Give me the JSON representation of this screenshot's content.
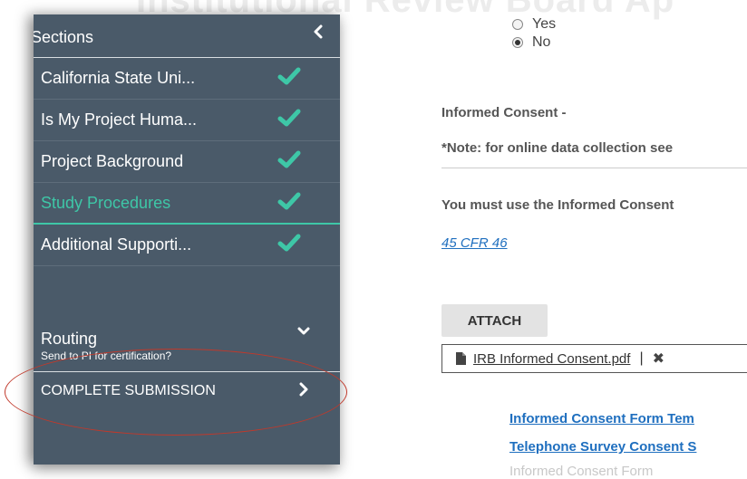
{
  "ghost_header": "Institutional Review Board Ap",
  "sidebar": {
    "title": "Sections",
    "items": [
      {
        "label": "California State Uni...",
        "complete": true,
        "active": false
      },
      {
        "label": "Is My Project Huma...",
        "complete": true,
        "active": false
      },
      {
        "label": "Project Background",
        "complete": true,
        "active": false
      },
      {
        "label": "Study Procedures",
        "complete": true,
        "active": true
      },
      {
        "label": "Additional Supporti...",
        "complete": true,
        "active": false
      }
    ],
    "routing": {
      "label": "Routing",
      "sub": "Send to PI for certification?"
    },
    "complete_submission": "COMPLETE SUBMISSION"
  },
  "content": {
    "radio_yes": "Yes",
    "radio_no": "No",
    "selected": "No",
    "informed_consent_heading": "Informed Consent -",
    "note": "*Note: for online data collection see",
    "must_use": "You must use the Informed Consent",
    "cfr_link": "45 CFR 46",
    "attach_label": "ATTACH",
    "file_name": "IRB Informed Consent.pdf",
    "template_link_1": "Informed Consent Form Tem",
    "template_link_2": "Telephone Survey Consent S",
    "template_link_3": "Informed Consent Form"
  },
  "colors": {
    "sidebar_bg": "#4a5a69",
    "accent": "#3ec7a7",
    "link": "#1f6fbf",
    "annotation": "#c0392b"
  }
}
